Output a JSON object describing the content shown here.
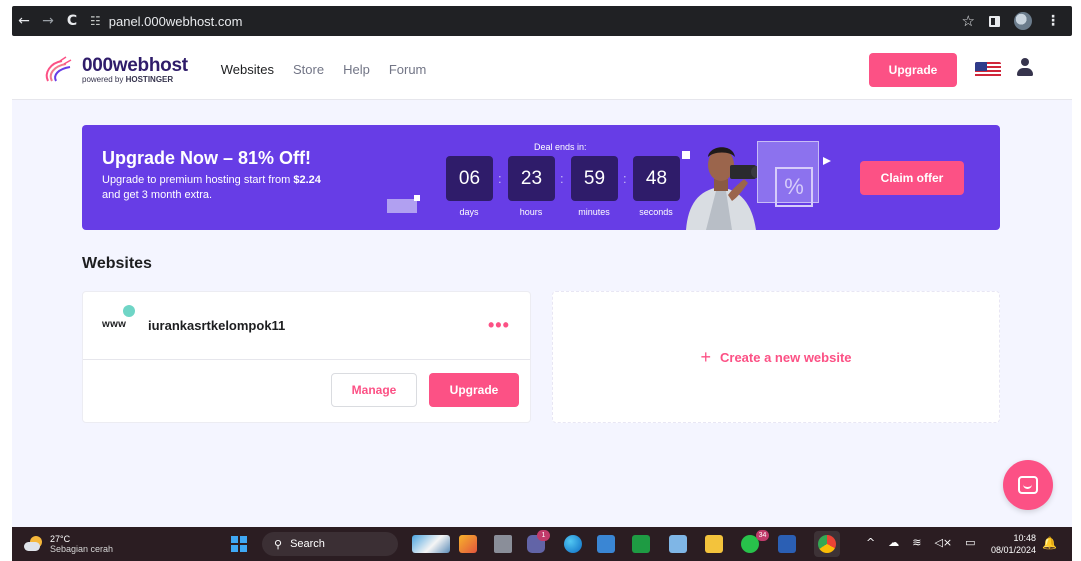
{
  "browser": {
    "url": "panel.000webhost.com",
    "back_glyph": "←",
    "forward_glyph": "→",
    "reload_glyph": "C",
    "site_info_glyph": "☷",
    "star_glyph": "☆",
    "menu_glyph": "⋮"
  },
  "header": {
    "logo_main": "000webhost",
    "logo_sub_prefix": "powered by ",
    "logo_sub_brand": "HOSTINGER",
    "nav": [
      {
        "label": "Websites"
      },
      {
        "label": "Store"
      },
      {
        "label": "Help"
      },
      {
        "label": "Forum"
      }
    ],
    "upgrade_label": "Upgrade"
  },
  "promo": {
    "title": "Upgrade Now – 81% Off!",
    "desc_line1_prefix": "Upgrade to premium hosting start from ",
    "desc_price": "$2.24",
    "desc_line2": "and get 3 month extra.",
    "deal_label": "Deal ends in:",
    "countdown": [
      {
        "value": "06",
        "label": "days"
      },
      {
        "value": "23",
        "label": "hours"
      },
      {
        "value": "59",
        "label": "minutes"
      },
      {
        "value": "48",
        "label": "seconds"
      }
    ],
    "separator": ":",
    "percent_glyph": "%",
    "claim_label": "Claim offer"
  },
  "websites": {
    "section_title": "Websites",
    "sites": [
      {
        "www_label": "www",
        "name": "iurankasrtkelompok11",
        "more_glyph": "•••",
        "manage_label": "Manage",
        "upgrade_label": "Upgrade"
      }
    ],
    "create_plus": "+",
    "create_label": "Create a new website"
  },
  "taskbar": {
    "temperature": "27°C",
    "weather_desc": "Sebagian cerah",
    "search_placeholder": "Search",
    "search_glyph": "⚲",
    "badge_teams": "1",
    "badge_whatsapp": "34",
    "tray_glyphs": [
      "^",
      "☁",
      "≋",
      "◁×",
      "▭"
    ],
    "time": "10:48",
    "date": "08/01/2024",
    "bell_glyph": "🔔"
  },
  "colors": {
    "brand_purple": "#673de6",
    "brand_dark": "#2f1c6a",
    "accent_pink": "#fc5185",
    "status_online": "#6fd5c6"
  }
}
